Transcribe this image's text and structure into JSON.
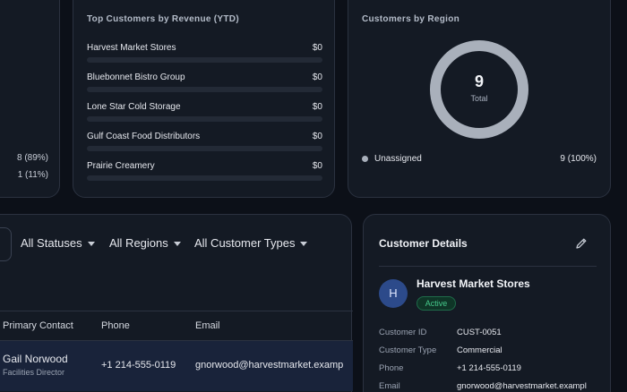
{
  "status_card": {
    "rows": [
      "8 (89%)",
      "1 (11%)"
    ]
  },
  "top_customers": {
    "title": "Top Customers by Revenue (YTD)",
    "items": [
      {
        "name": "Harvest Market Stores",
        "value": "$0"
      },
      {
        "name": "Bluebonnet Bistro Group",
        "value": "$0"
      },
      {
        "name": "Lone Star Cold Storage",
        "value": "$0"
      },
      {
        "name": "Gulf Coast Food Distributors",
        "value": "$0"
      },
      {
        "name": "Prairie Creamery",
        "value": "$0"
      }
    ],
    "bar_fractions": [
      0,
      0,
      0,
      0,
      0
    ]
  },
  "region": {
    "title": "Customers by Region",
    "total_value": "9",
    "total_label": "Total",
    "legend": [
      {
        "name": "Unassigned",
        "value": "9 (100%)",
        "color": "#a9b0bb"
      }
    ]
  },
  "chart_data": {
    "type": "pie",
    "title": "Customers by Region",
    "categories": [
      "Unassigned"
    ],
    "values": [
      9
    ]
  },
  "filters": {
    "status": "All Statuses",
    "region": "All Regions",
    "type": "All Customer Types"
  },
  "table": {
    "columns": [
      "Primary Contact",
      "Phone",
      "Email"
    ],
    "rows": [
      {
        "contact": "Gail Norwood",
        "title": "Facilities Director",
        "phone": "+1 214-555-0119",
        "email": "gnorwood@harvestmarket.examp"
      }
    ]
  },
  "details": {
    "title": "Customer Details",
    "avatar_letter": "H",
    "name": "Harvest Market Stores",
    "status": "Active",
    "fields": [
      {
        "label": "Customer ID",
        "value": "CUST-0051"
      },
      {
        "label": "Customer Type",
        "value": "Commercial"
      },
      {
        "label": "Phone",
        "value": "+1 214-555-0119"
      },
      {
        "label": "Email",
        "value": "gnorwood@harvestmarket.exampl"
      }
    ]
  },
  "colors": {
    "accent": "#5b7fd6",
    "active_green": "#46c98b",
    "donut": "#a9b0bb"
  }
}
